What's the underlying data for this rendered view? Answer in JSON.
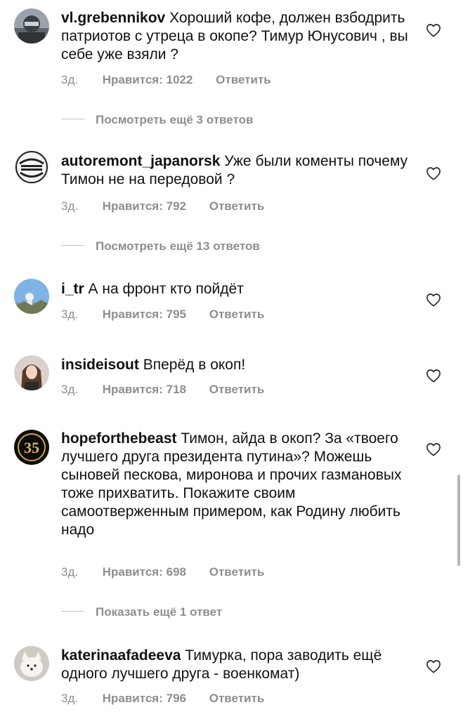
{
  "comments": [
    {
      "username": "vl.grebennikov",
      "text": "Хороший кофе, должен взбодрить патриотов с утреца в окопе? Тимур Юнусович , вы себе уже взяли ?",
      "time": "3д.",
      "likes": "Нравится: 1022",
      "reply": "Ответить",
      "avatar_icon": "avatar-helmet-photo"
    },
    {
      "username": "autoremont_japanorsk",
      "text": "Уже были коменты почему Тимон не на передовой ?",
      "time": "3д.",
      "likes": "Нравится: 792",
      "reply": "Ответить",
      "avatar_icon": "avatar-japan-emblem"
    },
    {
      "username": "i_tr",
      "text": "А на фронт кто пойдёт",
      "time": "3д.",
      "likes": "Нравится: 795",
      "reply": "Ответить",
      "avatar_icon": "avatar-sky-photo"
    },
    {
      "username": "insideisout",
      "text": "Вперёд в окоп!",
      "time": "3д.",
      "likes": "Нравится: 718",
      "reply": "Ответить",
      "avatar_icon": "avatar-woman-photo"
    },
    {
      "username": "hopeforthebeast",
      "text": "Тимон, айда в окоп? За «твоего лучшего друга президента путина»? Можешь сыновей пескова, миронова и прочих газмановых тоже прихватить. Покажите своим самоотверженным примером, как Родину любить надо",
      "time": "3д.",
      "likes": "Нравится: 698",
      "reply": "Ответить",
      "avatar_icon": "avatar-35-logo"
    },
    {
      "username": "katerinaafadeeva",
      "text": "Тимурка, пора заводить ещё одного лучшего друга - военкомат)",
      "time": "3д.",
      "likes": "Нравится: 796",
      "reply": "Ответить",
      "avatar_icon": "avatar-white-dog-photo"
    }
  ],
  "replies_links": [
    "Посмотреть ещё 3 ответов",
    "Посмотреть ещё 13 ответов",
    "Показать ещё 1 ответ"
  ],
  "colors": {
    "text": "#111111",
    "meta": "#8e8e8e",
    "divider": "#c7c7c7",
    "background": "#ffffff"
  },
  "icons": {
    "like": "heart-outline-icon"
  }
}
